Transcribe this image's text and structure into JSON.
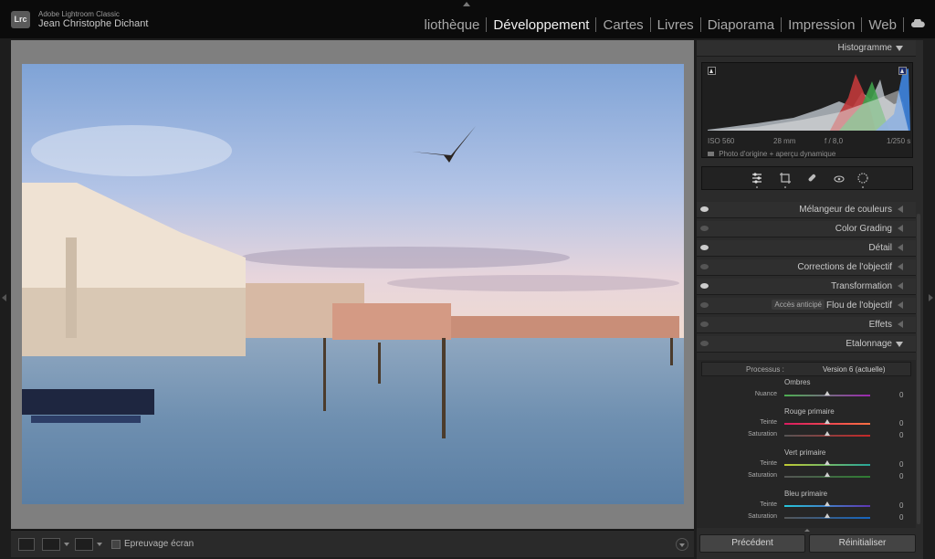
{
  "app": {
    "name": "Adobe Lightroom Classic",
    "logo": "Lrc",
    "user": "Jean Christophe Dichant"
  },
  "modules": [
    {
      "label": "liothèque",
      "active": false
    },
    {
      "label": "Développement",
      "active": true
    },
    {
      "label": "Cartes",
      "active": false
    },
    {
      "label": "Livres",
      "active": false
    },
    {
      "label": "Diaporama",
      "active": false
    },
    {
      "label": "Impression",
      "active": false
    },
    {
      "label": "Web",
      "active": false
    }
  ],
  "histogram": {
    "title": "Histogramme",
    "iso": "ISO 560",
    "focal": "28 mm",
    "aperture": "f / 8,0",
    "shutter": "1/250 s",
    "source": "Photo d'origine + aperçu dynamique"
  },
  "panels": [
    {
      "label": "Mélangeur de couleurs",
      "eye": true
    },
    {
      "label": "Color Grading",
      "eye": false
    },
    {
      "label": "Détail",
      "eye": true
    },
    {
      "label": "Corrections de l'objectif",
      "eye": false
    },
    {
      "label": "Transformation",
      "eye": true
    },
    {
      "label": "Flou de l'objectif",
      "eye": false,
      "badge": "Accès anticipé"
    },
    {
      "label": "Effets",
      "eye": false
    },
    {
      "label": "Etalonnage",
      "eye": false,
      "expanded": true
    }
  ],
  "calibration": {
    "process_label": "Processus :",
    "process_value": "Version 6 (actuelle)",
    "groups": [
      {
        "title": "Ombres",
        "rows": [
          {
            "label": "Nuance",
            "value": "0"
          }
        ]
      },
      {
        "title": "Rouge primaire",
        "rows": [
          {
            "label": "Teinte",
            "value": "0"
          },
          {
            "label": "Saturation",
            "value": "0"
          }
        ]
      },
      {
        "title": "Vert primaire",
        "rows": [
          {
            "label": "Teinte",
            "value": "0"
          },
          {
            "label": "Saturation",
            "value": "0"
          }
        ]
      },
      {
        "title": "Bleu primaire",
        "rows": [
          {
            "label": "Teinte",
            "value": "0"
          },
          {
            "label": "Saturation",
            "value": "0"
          }
        ]
      }
    ]
  },
  "buttons": {
    "previous": "Précédent",
    "reset": "Réinitialiser"
  },
  "toolbar": {
    "softproof": "Epreuvage écran"
  }
}
